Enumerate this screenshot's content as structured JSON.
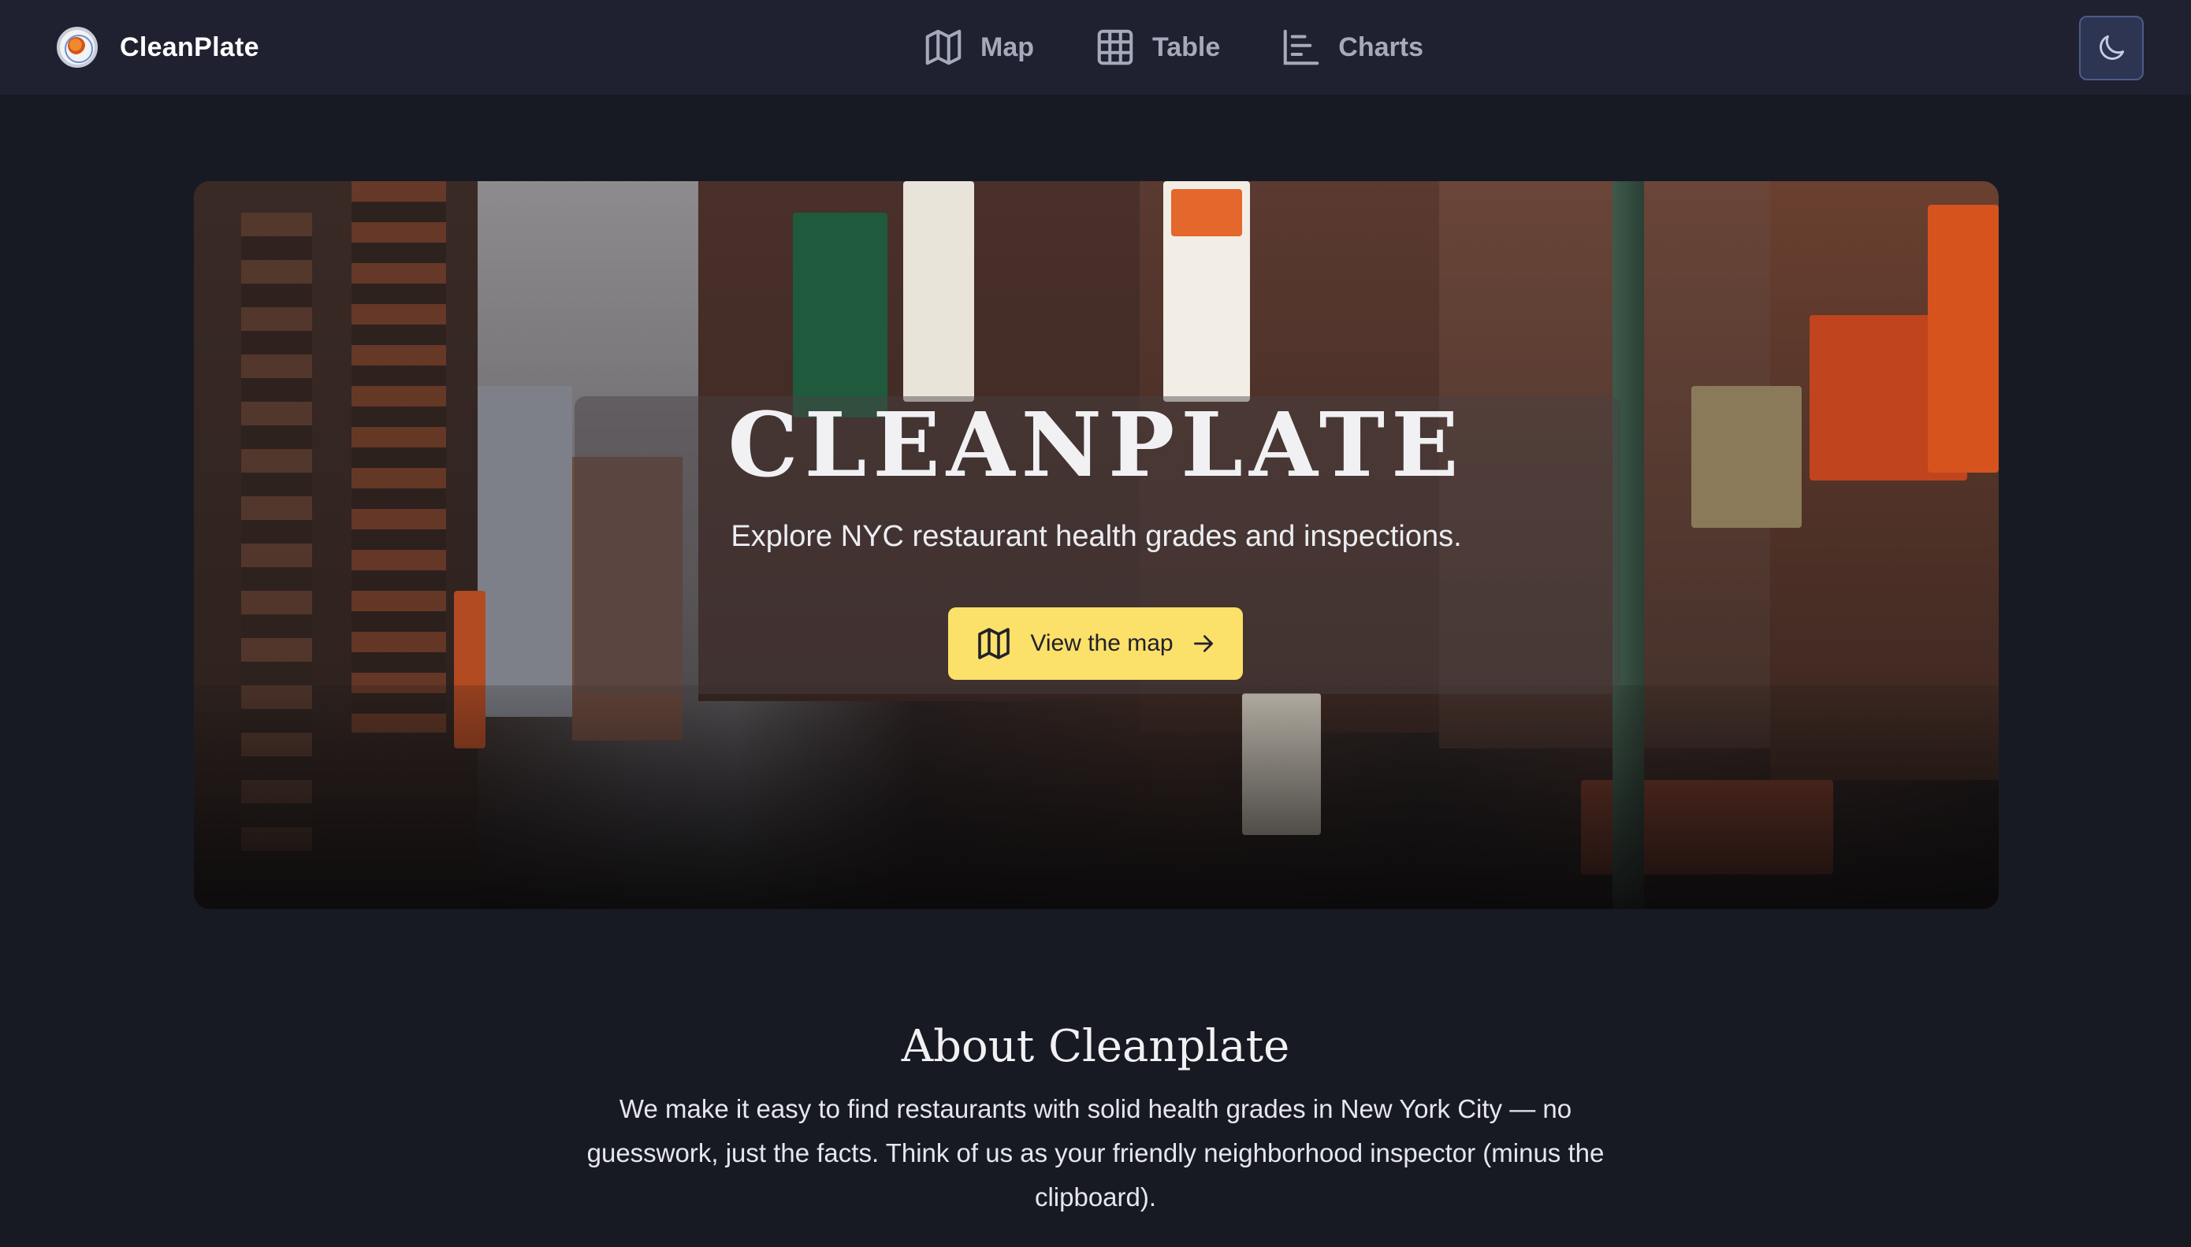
{
  "brand": {
    "name": "CleanPlate"
  },
  "nav": {
    "items": [
      {
        "label": "Map",
        "icon": "map-icon"
      },
      {
        "label": "Table",
        "icon": "table-icon"
      },
      {
        "label": "Charts",
        "icon": "bar-chart-icon"
      }
    ],
    "theme_toggle_icon": "moon-icon"
  },
  "hero": {
    "title": "CLEANPLATE",
    "subtitle": "Explore NYC restaurant health grades and inspections.",
    "cta_label": "View the map",
    "cta_icon": "map-icon",
    "cta_arrow_icon": "arrow-right-icon",
    "background_image": "street scene photo"
  },
  "about": {
    "title": "About Cleanplate",
    "text": "We make it easy to find restaurants with solid health grades in New York City — no guesswork, just the facts. Think of us as your friendly neighborhood inspector (minus the clipboard)."
  },
  "colors": {
    "background": "#181a23",
    "navbar": "#1f2130",
    "nav_text": "#a5aabb",
    "cta": "#fbe06a",
    "toggle_bg": "#2d3553"
  }
}
